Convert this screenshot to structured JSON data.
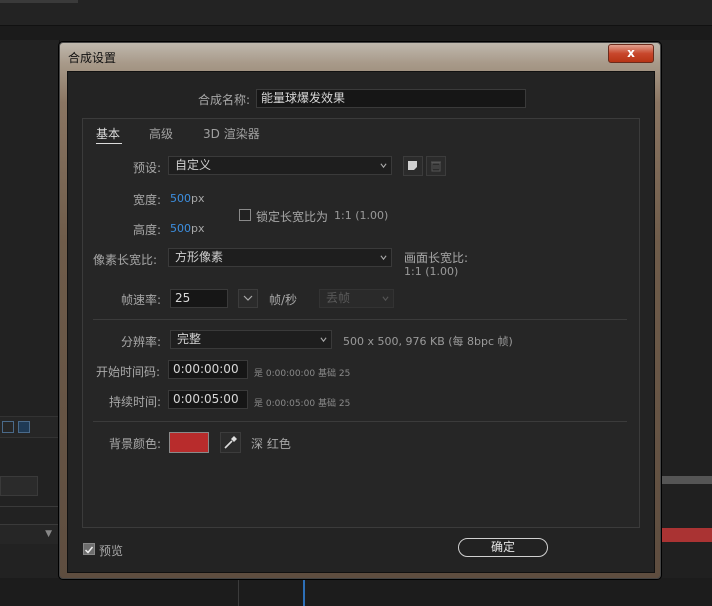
{
  "dialog": {
    "title": "合成设置",
    "close_label": "x"
  },
  "comp_name": {
    "label": "合成名称:",
    "value": "能量球爆发效果"
  },
  "tabs": [
    {
      "label": "基本",
      "active": true
    },
    {
      "label": "高级",
      "active": false
    },
    {
      "label": "3D 渲染器",
      "active": false
    }
  ],
  "preset": {
    "label": "预设:",
    "value": "自定义"
  },
  "width": {
    "label": "宽度:",
    "value": "500",
    "unit": "px"
  },
  "height": {
    "label": "高度:",
    "value": "500",
    "unit": "px"
  },
  "lock_aspect": {
    "label": "锁定长宽比为",
    "ratio": "1:1 (1.00)",
    "checked": false
  },
  "pixel_aspect": {
    "label": "像素长宽比:",
    "value": "方形像素"
  },
  "frame_aspect": {
    "label": "画面长宽比:",
    "value": "1:1 (1.00)"
  },
  "frame_rate": {
    "label": "帧速率:",
    "value": "25",
    "unit": "帧/秒",
    "drop_frame": "丢帧"
  },
  "resolution": {
    "label": "分辨率:",
    "value": "完整",
    "info": "500 x 500, 976 KB (每 8bpc 帧)"
  },
  "start_timecode": {
    "label": "开始时间码:",
    "value": "0:00:00:00",
    "info": "是 0:00:00:00",
    "base": "基础 25"
  },
  "duration": {
    "label": "持续时间:",
    "value": "0:00:05:00",
    "info": "是 0:00:05:00",
    "base": "基础 25"
  },
  "background": {
    "label": "背景颜色:",
    "color": "#b82c2c",
    "name": "深 红色"
  },
  "preview": {
    "label": "预览",
    "checked": true
  },
  "ok_label": "确定",
  "colors": {
    "accent_blue": "#3c8fe0",
    "close_red": "#c8472c"
  }
}
